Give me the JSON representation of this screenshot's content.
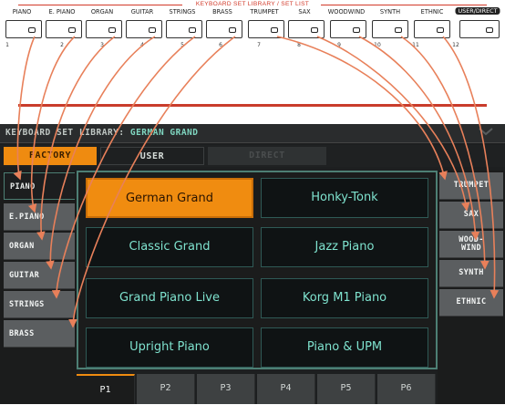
{
  "keyboard_panel": {
    "caption": "KEYBOARD SET LIBRARY / SET LIST",
    "categories": [
      "PIANO",
      "E. PIANO",
      "ORGAN",
      "GUITAR",
      "STRINGS",
      "BRASS",
      "TRUMPET",
      "SAX",
      "WOODWIND",
      "SYNTH",
      "ETHNIC",
      "USER/DIRECT"
    ],
    "numbers": [
      "1",
      "2",
      "3",
      "4",
      "5",
      "6",
      "7",
      "8",
      "9",
      "10",
      "11",
      "12"
    ]
  },
  "display": {
    "title_label": "KEYBOARD SET LIBRARY:",
    "title_value": "GERMAN GRAND",
    "tabs": {
      "factory": "FACTORY",
      "user": "USER",
      "direct": "DIRECT"
    },
    "left_categories": [
      "PIANO",
      "E.PIANO",
      "ORGAN",
      "GUITAR",
      "STRINGS",
      "BRASS"
    ],
    "right_categories": [
      "TRUMPET",
      "SAX",
      "WOOD-\nWIND",
      "SYNTH",
      "ETHNIC"
    ],
    "sounds": [
      "German Grand",
      "Honky-Tonk",
      "Classic Grand",
      "Jazz Piano",
      "Grand Piano Live",
      "Korg M1 Piano",
      "Upright Piano",
      "Piano & UPM"
    ],
    "selected_sound": "German Grand",
    "pages": [
      "P1",
      "P2",
      "P3",
      "P4",
      "P5",
      "P6"
    ],
    "active_page": "P1"
  },
  "colors": {
    "accent": "#ef8b10",
    "arrow": "#e8805a",
    "caption_red": "#d23a2a",
    "sound_text": "#7fe3cf",
    "frame": "#4d7f74"
  },
  "icons": {
    "header_collapse": "chevron-down-icon"
  }
}
